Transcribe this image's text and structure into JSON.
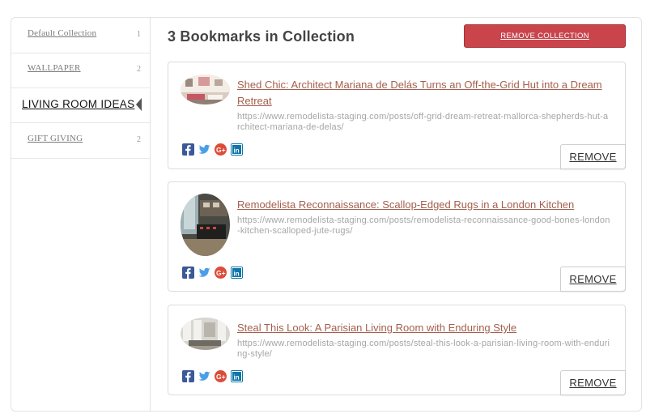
{
  "sidebar": {
    "items": [
      {
        "label": "Default Collection",
        "count": "1"
      },
      {
        "label": "WALLPAPER",
        "count": "2"
      },
      {
        "label": "LIVING ROOM IDEAS",
        "count": ""
      },
      {
        "label": "GIFT GIVING",
        "count": "2"
      }
    ],
    "active_index": 2
  },
  "header": {
    "title": "3 Bookmarks in Collection",
    "remove_collection_label": "REMOVE COLLECTION"
  },
  "bookmarks": [
    {
      "title": "Shed Chic: Architect Mariana de Delás Turns an Off-the-Grid Hut into a Dream Retreat",
      "url": "https://www.remodelista-staging.com/posts/off-grid-dream-retreat-mallorca-shepherds-hut-architect-mariana-de-delas/",
      "remove_label": "REMOVE"
    },
    {
      "title": "Remodelista Reconnaissance: Scallop-Edged Rugs in a London Kitchen",
      "url": "https://www.remodelista-staging.com/posts/remodelista-reconnaissance-good-bones-london-kitchen-scalloped-jute-rugs/",
      "remove_label": "REMOVE"
    },
    {
      "title": "Steal This Look: A Parisian Living Room with Enduring Style",
      "url": "https://www.remodelista-staging.com/posts/steal-this-look-a-parisian-living-room-with-enduring-style/",
      "remove_label": "REMOVE"
    }
  ],
  "share_icons": [
    "facebook-icon",
    "twitter-icon",
    "google-plus-icon",
    "linkedin-icon"
  ],
  "colors": {
    "accent_red": "#c9444b",
    "link": "#a45f4d",
    "facebook": "#3b5998",
    "twitter": "#4b9ee8",
    "google_plus": "#dd4b39",
    "linkedin": "#0e76a8"
  }
}
